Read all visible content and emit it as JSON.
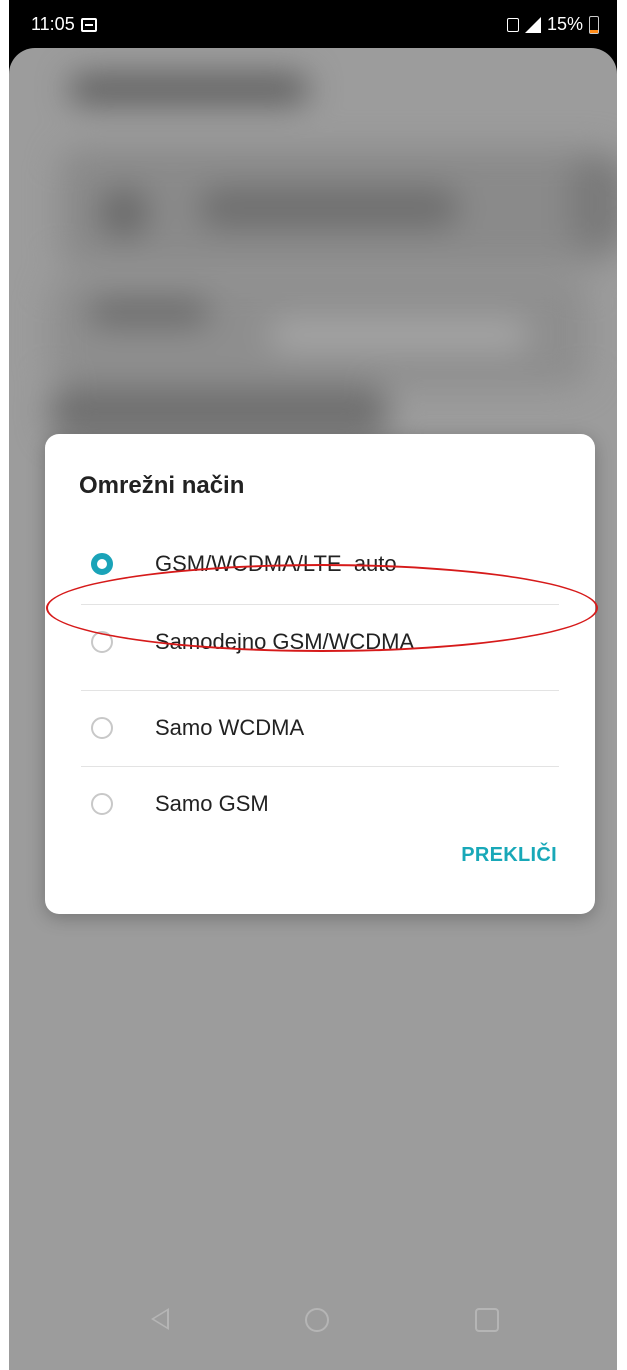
{
  "status_bar": {
    "time": "11:05",
    "battery_percent": "15%",
    "left_icons": [
      "gallery-icon"
    ],
    "right_icons": [
      "sim-icon",
      "signal-icon",
      "battery-icon"
    ],
    "battery_level": 0.15,
    "battery_color": "#ff8c1a"
  },
  "dialog": {
    "title": "Omrežni način",
    "options": [
      {
        "label": "GSM/WCDMA/LTE  auto",
        "selected": true
      },
      {
        "label": "Samodejno GSM/WCDMA",
        "selected": false
      },
      {
        "label": "Samo WCDMA",
        "selected": false
      },
      {
        "label": "Samo GSM",
        "selected": false
      }
    ],
    "cancel_label": "PREKLIČI",
    "accent_color": "#1aa3b8"
  },
  "annotation": {
    "highlight_color": "#d61a1a",
    "highlighted_option": "GSM/WCDMA/LTE  auto"
  },
  "nav_bar": {
    "icons": [
      "back-icon",
      "home-icon",
      "recent-apps-icon"
    ]
  }
}
